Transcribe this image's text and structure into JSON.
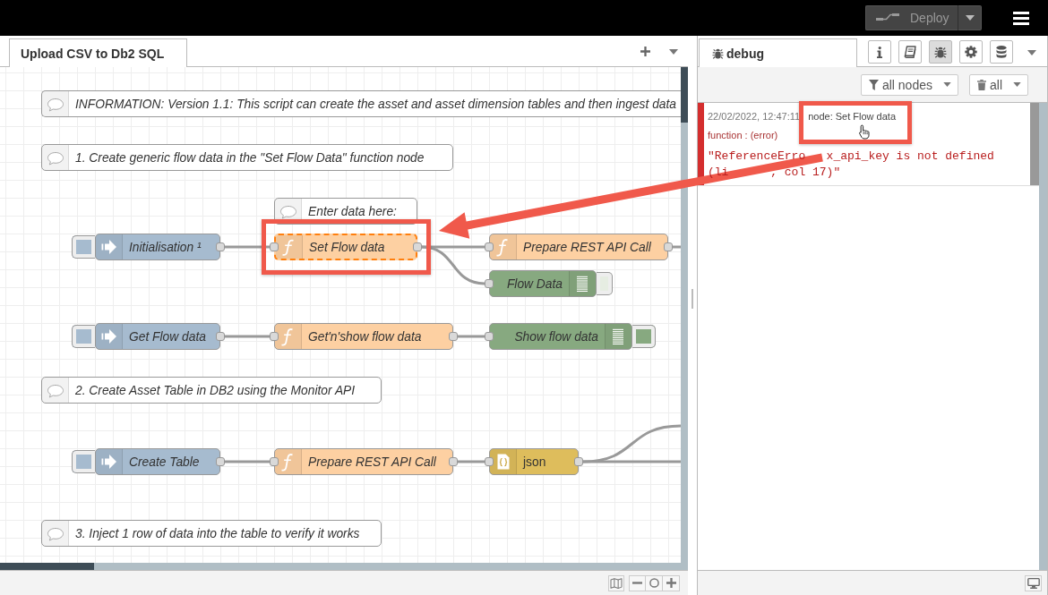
{
  "header": {
    "deploy_button": {
      "label": "Deploy",
      "disabled": true
    }
  },
  "workspace": {
    "tabs": [
      {
        "label": "Upload CSV to Db2 SQL",
        "selected": true
      }
    ],
    "nodes": [
      {
        "kind": "comment",
        "label": "INFORMATION: Version 1.1: This script can create the asset and asset dimension tables and then ingest data",
        "italic": true,
        "selected": false
      },
      {
        "kind": "comment",
        "label": "1. Create generic flow data in the \"Set Flow Data\" function node",
        "italic": true,
        "selected": false
      },
      {
        "kind": "comment",
        "label": "Enter data here:",
        "italic": true,
        "selected": false
      },
      {
        "kind": "inject",
        "label": "Initialisation ¹",
        "italic": true,
        "selected": false
      },
      {
        "kind": "function",
        "label": "Set Flow data",
        "italic": true,
        "selected": true
      },
      {
        "kind": "function",
        "label": "Prepare REST API Call",
        "italic": true,
        "selected": false
      },
      {
        "kind": "debug",
        "label": "Flow Data",
        "italic": true,
        "selected": false,
        "active": false
      },
      {
        "kind": "inject",
        "label": "Get Flow data",
        "italic": true,
        "selected": false
      },
      {
        "kind": "function",
        "label": "Get'n'show flow data",
        "italic": true,
        "selected": false
      },
      {
        "kind": "debug",
        "label": "Show flow data",
        "italic": true,
        "selected": false,
        "active": true
      },
      {
        "kind": "comment",
        "label": "2. Create Asset Table in DB2 using the Monitor API",
        "italic": true,
        "selected": false
      },
      {
        "kind": "inject",
        "label": "Create Table",
        "italic": true,
        "selected": false
      },
      {
        "kind": "function",
        "label": "Prepare REST API Call",
        "italic": true,
        "selected": false
      },
      {
        "kind": "json",
        "label": "json",
        "italic": false,
        "selected": false
      },
      {
        "kind": "comment",
        "label": "3. Inject 1 row of data into the table to verify it works",
        "italic": true,
        "selected": false
      }
    ]
  },
  "sidebar": {
    "tabs": [
      {
        "label": "debug",
        "selected": true
      }
    ],
    "tab_buttons": [
      {
        "selected": false
      },
      {
        "selected": false
      },
      {
        "selected": true
      },
      {
        "selected": false
      },
      {
        "selected": false
      }
    ],
    "filter_button": {
      "label": "all nodes"
    },
    "clear_button": {
      "label": "all"
    },
    "messages": [
      {
        "error": true,
        "timestamp": "22/02/2022, 12:47:11",
        "node": "node: Set Flow data",
        "source": "function : (error)",
        "lines": [
          [
            "\"ReferenceErro",
            "x_api_key is not defined"
          ],
          [
            "(li",
            ", col 17)\""
          ]
        ]
      }
    ]
  }
}
